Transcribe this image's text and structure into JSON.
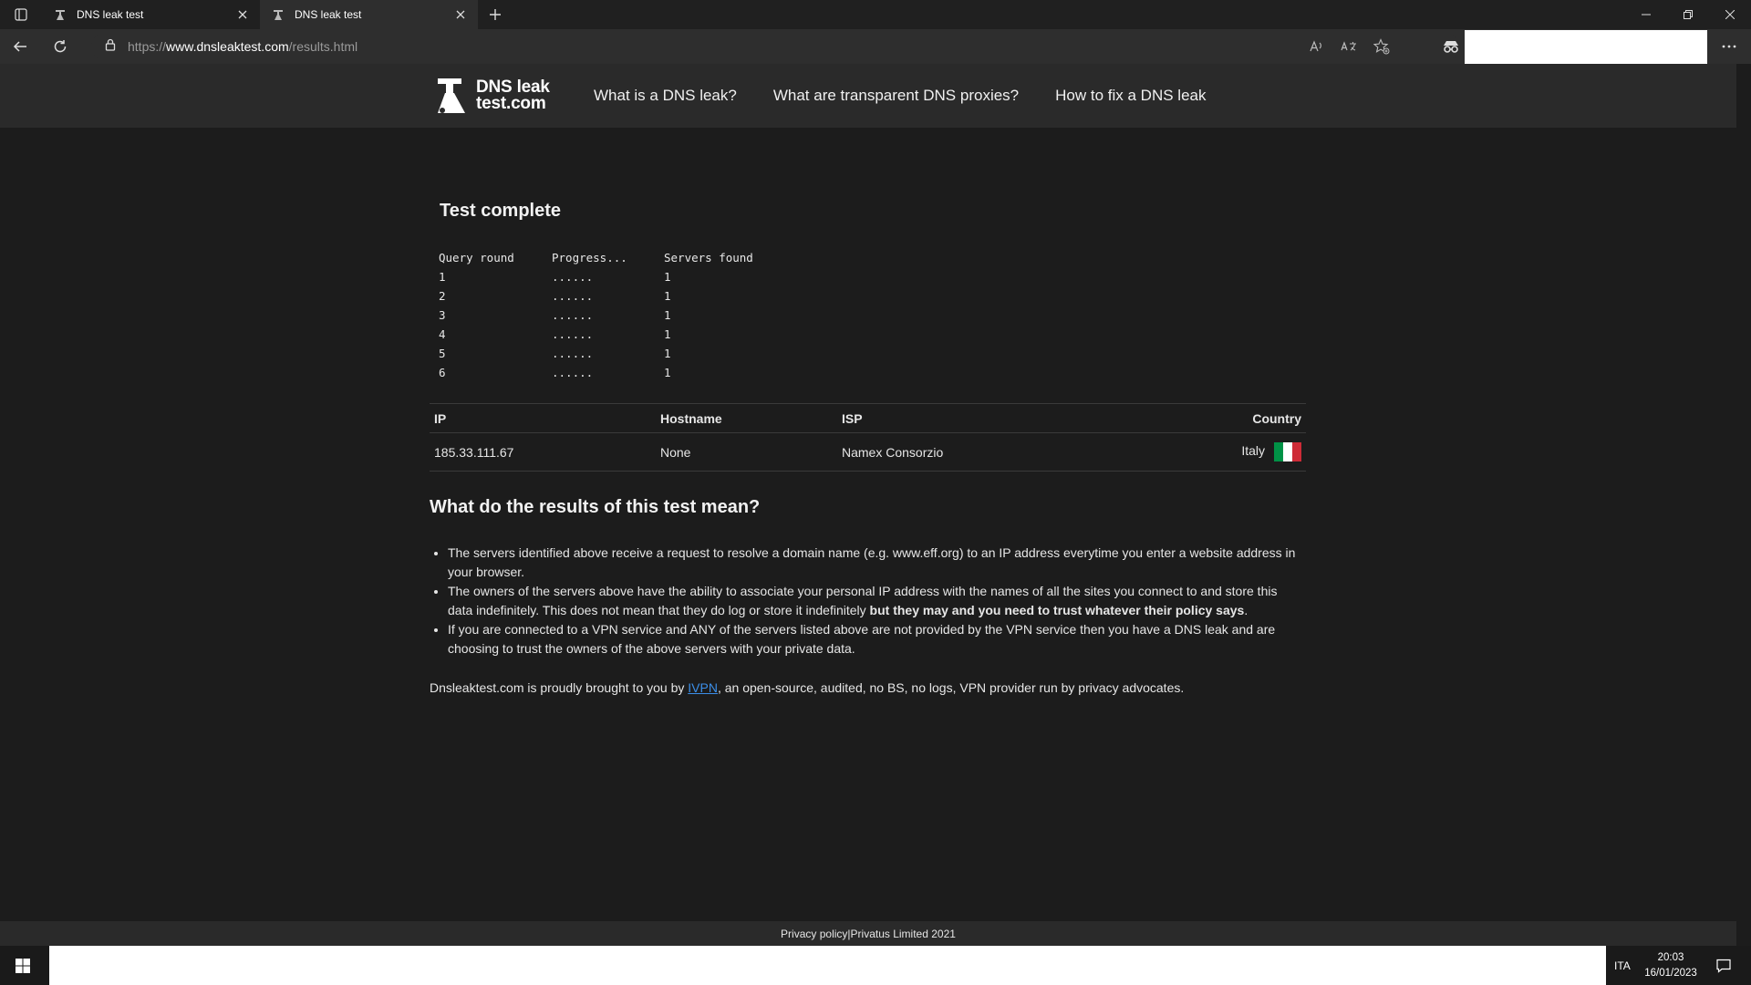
{
  "browser": {
    "tabs": [
      {
        "title": "DNS leak test",
        "active": false
      },
      {
        "title": "DNS leak test",
        "active": true
      }
    ],
    "url_prefix": "https://",
    "url_host": "www.dnsleaktest.com",
    "url_path": "/results.html"
  },
  "site": {
    "logo_line1": "DNS leak",
    "logo_line2": "test.com",
    "nav": [
      "What is a DNS leak?",
      "What are transparent DNS proxies?",
      "How to fix a DNS leak"
    ]
  },
  "test": {
    "title": "Test complete",
    "round_headers": [
      "Query round",
      "Progress...",
      "Servers found"
    ],
    "rounds": [
      {
        "round": "1",
        "progress": "......",
        "servers": "1"
      },
      {
        "round": "2",
        "progress": "......",
        "servers": "1"
      },
      {
        "round": "3",
        "progress": "......",
        "servers": "1"
      },
      {
        "round": "4",
        "progress": "......",
        "servers": "1"
      },
      {
        "round": "5",
        "progress": "......",
        "servers": "1"
      },
      {
        "round": "6",
        "progress": "......",
        "servers": "1"
      }
    ]
  },
  "results": {
    "headers": [
      "IP",
      "Hostname",
      "ISP",
      "Country"
    ],
    "rows": [
      {
        "ip": "185.33.111.67",
        "hostname": "None",
        "isp": "Namex Consorzio",
        "country": "Italy"
      }
    ],
    "flag_colors": [
      "#009246",
      "#ffffff",
      "#ce2b37"
    ]
  },
  "explanation": {
    "heading": "What do the results of this test mean?",
    "items": [
      {
        "text": "The servers identified above receive a request to resolve a domain name (e.g. www.eff.org) to an IP address everytime you enter a website address in your browser.",
        "bold": ""
      },
      {
        "text": "The owners of the servers above have the ability to associate your personal IP address with the names of all the sites you connect to and store this data indefinitely. This does not mean that they do log or store it indefinitely ",
        "bold": "but they may and you need to trust whatever their policy says",
        "tail": "."
      },
      {
        "text": "If you are connected to a VPN service and ANY of the servers listed above are not provided by the VPN service then you have a DNS leak and are choosing to trust the owners of the above servers with your private data.",
        "bold": ""
      }
    ]
  },
  "credit": {
    "before": "Dnsleaktest.com is proudly brought to you by ",
    "link": "IVPN",
    "after": ", an open-source, audited, no BS, no logs, VPN provider run by privacy advocates."
  },
  "footer": {
    "privacy": "Privacy policy",
    "separator": " | ",
    "company": "Privatus Limited 2021"
  },
  "taskbar": {
    "lang": "ITA",
    "time": "20:03",
    "date": "16/01/2023"
  },
  "colors": {
    "link": "#3b8ee8",
    "page_bg": "#1c1c1c",
    "header_bg": "#2a2a2a"
  }
}
